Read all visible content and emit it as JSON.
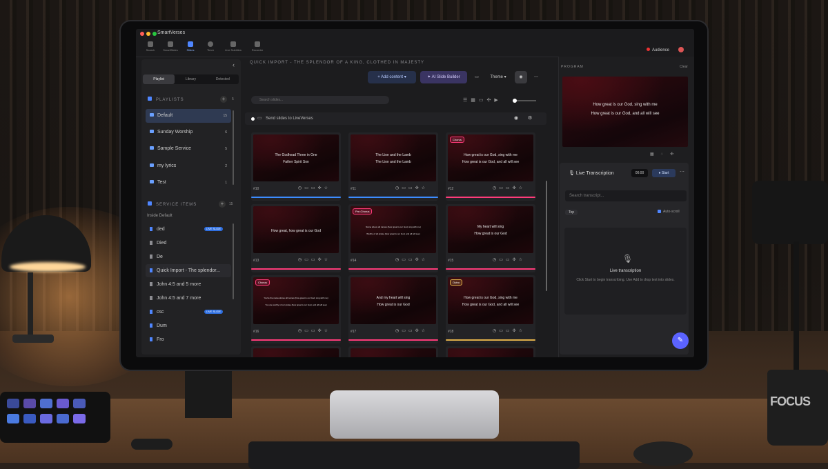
{
  "app": {
    "title": "SmartVerses",
    "audience_label": "Audience"
  },
  "nav": [
    {
      "label": "Search"
    },
    {
      "label": "SmartSlides"
    },
    {
      "label": "Slides"
    },
    {
      "label": "Timer"
    },
    {
      "label": "Live Subtitles"
    },
    {
      "label": "Recorder"
    }
  ],
  "left": {
    "tabs": [
      "Playlist",
      "Library",
      "Detected"
    ],
    "playlists_title": "PLAYLISTS",
    "playlists_count": "5",
    "playlists": [
      {
        "name": "Default",
        "count": "15"
      },
      {
        "name": "Sunday Worship",
        "count": "6"
      },
      {
        "name": "Sample Service",
        "count": "5"
      },
      {
        "name": "my lyrics",
        "count": "2"
      },
      {
        "name": "Test",
        "count": "1"
      }
    ],
    "service_title": "SERVICE ITEMS",
    "service_count": "15",
    "inside": "Inside Default",
    "service_items": [
      {
        "name": "ded",
        "badge": "LIVE SLIDE"
      },
      {
        "name": "Died",
        "badge": ""
      },
      {
        "name": "De",
        "badge": ""
      },
      {
        "name": "Quick Import - The splendor...",
        "badge": ""
      },
      {
        "name": "John 4:5 and 5 more",
        "badge": ""
      },
      {
        "name": "John 4:5 and 7 more",
        "badge": ""
      },
      {
        "name": "csc",
        "badge": "LIVE SLIDE"
      },
      {
        "name": "Dum",
        "badge": ""
      },
      {
        "name": "Fro",
        "badge": ""
      }
    ]
  },
  "center": {
    "breadcrumb": "QUICK IMPORT - THE SPLENDOR OF A KING, CLOTHED IN MAJESTY",
    "add_content": "+ Add content",
    "ai_builder": "AI Slide Builder",
    "theme": "Theme",
    "search_placeholder": "Search slides...",
    "send_label": "Send slides to LiveVerses",
    "slides": [
      {
        "num": "#10",
        "tag": "",
        "l1": "The Godhead Three in One",
        "l2": "Father Spirit Son",
        "bar": "#3c8cff",
        "small": false
      },
      {
        "num": "#11",
        "tag": "",
        "l1": "The Lion and the Lamb",
        "l2": "The Lion and the Lamb",
        "bar": "#3c8cff",
        "small": false
      },
      {
        "num": "#12",
        "tag": "Chorus",
        "l1": "How great is our God, sing with me",
        "l2": "How great is our God, and all will see",
        "bar": "#ff3b7a",
        "small": false
      },
      {
        "num": "#13",
        "tag": "",
        "l1": "How great, how great is our God",
        "l2": "",
        "bar": "#ff3b7a",
        "small": false
      },
      {
        "num": "#14",
        "tag": "Pre-Chorus",
        "l1": "Name above all names (how great is our God, sing with me)",
        "l2": "Worthy of all praise (how great is our God, and all will see)",
        "bar": "#ff3b7a",
        "small": true
      },
      {
        "num": "#15",
        "tag": "",
        "l1": "My heart will sing",
        "l2": "How great is our God",
        "bar": "#ff3b7a",
        "small": false
      },
      {
        "num": "#16",
        "tag": "Chorus",
        "l1": "You're the name above all names (how great is our God, sing with me)",
        "l2": "You are worthy of our praise (how great is our God, and all will see)",
        "bar": "#ff3b7a",
        "small": true
      },
      {
        "num": "#17",
        "tag": "",
        "l1": "And my heart will sing",
        "l2": "How great is our God",
        "bar": "#ff3b7a",
        "small": false
      },
      {
        "num": "#18",
        "tag": "Outro",
        "l1": "How great is our God, sing with me",
        "l2": "How great is our God, and all will see",
        "bar": "#e0b04a",
        "small": false
      }
    ]
  },
  "right": {
    "program_label": "PROGRAM",
    "clear_label": "Clear",
    "program_l1": "How great is our God, sing with me",
    "program_l2": "How great is our God, and all will see",
    "lt_title": "Live Transcription",
    "time": "00:00",
    "start": "Start",
    "search_placeholder": "Search transcript...",
    "top_label": "Top",
    "autoscroll": "Auto-scroll",
    "empty_title": "Live transcription",
    "empty_text": "Click Start to begin transcribing. Use Add to drop text into slides."
  },
  "environment": {
    "mug_text": "FOCUS"
  },
  "colors": {
    "accent": "#4f86ff",
    "chorus": "#ff3b7a",
    "outro": "#e0b04a",
    "fab": "#5b63ff"
  }
}
